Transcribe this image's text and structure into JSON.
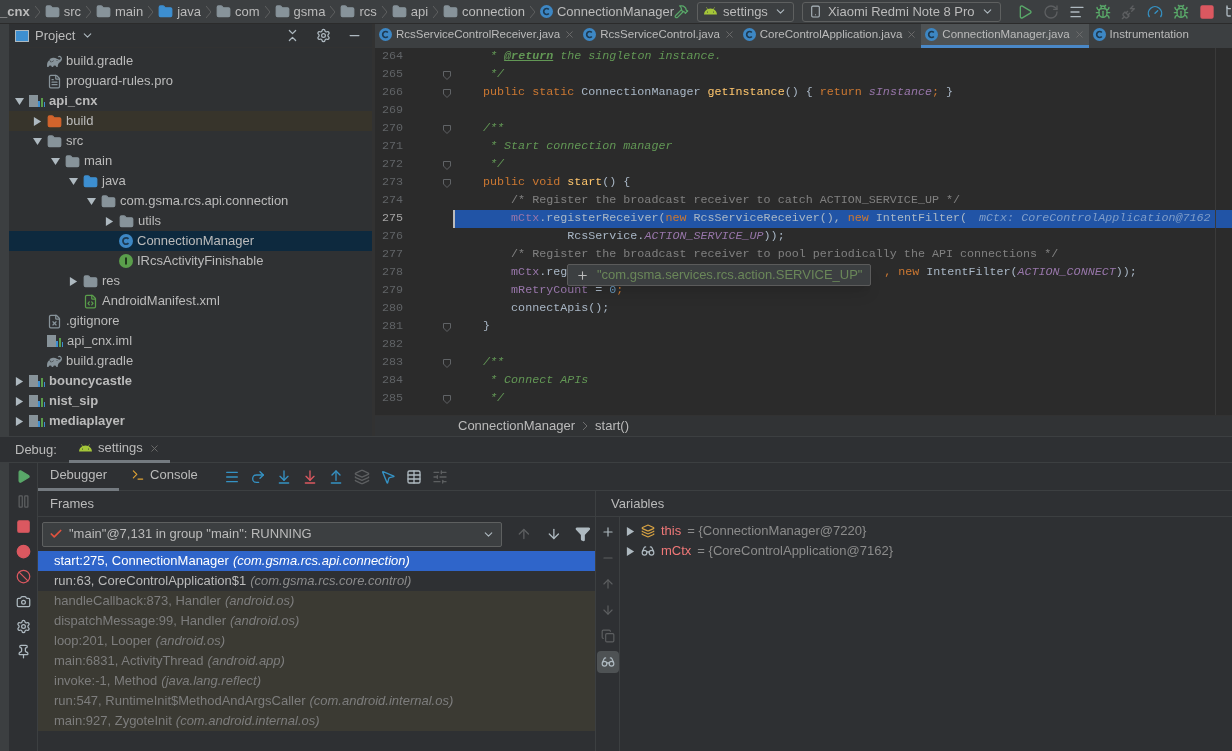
{
  "breadcrumbs": [
    {
      "label": "_cnx",
      "kind": "module"
    },
    {
      "label": "src",
      "kind": "folder"
    },
    {
      "label": "main",
      "kind": "folder"
    },
    {
      "label": "java",
      "kind": "source"
    },
    {
      "label": "com",
      "kind": "package"
    },
    {
      "label": "gsma",
      "kind": "package"
    },
    {
      "label": "rcs",
      "kind": "package"
    },
    {
      "label": "api",
      "kind": "package"
    },
    {
      "label": "connection",
      "kind": "package"
    },
    {
      "label": "ConnectionManager",
      "kind": "class"
    }
  ],
  "toolbar": {
    "run_config": "settings",
    "device": "Xiaomi Redmi Note 8 Pro",
    "icons": [
      {
        "kind": "run",
        "disabled": false
      },
      {
        "kind": "rerun",
        "disabled": true
      },
      {
        "kind": "coverage",
        "disabled": false
      },
      {
        "kind": "debug",
        "disabled": false
      },
      {
        "kind": "attach",
        "disabled": true
      },
      {
        "kind": "profile",
        "disabled": false
      },
      {
        "kind": "attach_debugger",
        "disabled": false
      },
      {
        "kind": "stop",
        "disabled": false
      },
      {
        "kind": "structure",
        "disabled": false
      }
    ]
  },
  "project_panel": {
    "title": "Project",
    "tree": [
      {
        "children": [
          {
            "label": "build.gradle",
            "kind": "gradle"
          },
          {
            "label": "proguard-rules.pro",
            "kind": "file"
          }
        ]
      },
      {
        "label": "api_cnx",
        "kind": "module",
        "expanded": true,
        "selected": false,
        "children": [
          {
            "label": "build",
            "kind": "excluded",
            "expanded": false,
            "selected": false
          },
          {
            "label": "src",
            "kind": "folder",
            "expanded": true,
            "selected": false,
            "children": [
              {
                "label": "main",
                "kind": "folder",
                "expanded": true,
                "selected": false,
                "children": [
                  {
                    "label": "java",
                    "kind": "source",
                    "expanded": true,
                    "selected": false,
                    "children": [
                      {
                        "label": "com.gsma.rcs.api.connection",
                        "kind": "package",
                        "expanded": true,
                        "selected": false,
                        "children": [
                          {
                            "label": "utils",
                            "kind": "package",
                            "expanded": false,
                            "selected": false
                          },
                          {
                            "label": "ConnectionManager",
                            "kind": "class",
                            "selected": true
                          },
                          {
                            "label": "IRcsActivityFinishable",
                            "kind": "interface",
                            "selected": false
                          }
                        ]
                      }
                    ]
                  },
                  {
                    "label": "res",
                    "kind": "res",
                    "expanded": false,
                    "selected": false
                  },
                  {
                    "label": "AndroidManifest.xml",
                    "kind": "manifest",
                    "selected": false
                  }
                ]
              }
            ]
          },
          {
            "label": ".gitignore",
            "kind": "gitignore",
            "selected": false
          },
          {
            "label": "api_cnx.iml",
            "kind": "iml",
            "selected": false
          },
          {
            "label": "build.gradle",
            "kind": "gradle",
            "selected": false
          }
        ]
      },
      {
        "label": "bouncycastle",
        "kind": "module",
        "expanded": false,
        "selected": false
      },
      {
        "label": "nist_sip",
        "kind": "module",
        "expanded": false,
        "selected": false
      },
      {
        "label": "mediaplayer",
        "kind": "module",
        "expanded": false,
        "selected": false
      }
    ]
  },
  "tabs": [
    {
      "label": "RcsServiceControlReceiver.java",
      "selected": false
    },
    {
      "label": "RcsServiceControl.java",
      "selected": false
    },
    {
      "label": "CoreControlApplication.java",
      "selected": false
    },
    {
      "label": "ConnectionManager.java",
      "selected": true
    },
    {
      "label": "Instrumentation",
      "selected": false
    }
  ],
  "code": [
    {
      "num": "264",
      "fold": false,
      "current": false,
      "parts": [
        [
          {
            "kind": "doc",
            "text": "     * "
          },
          {
            "kind": "doctag",
            "text": "@return"
          },
          {
            "kind": "doc",
            "text": " the singleton instance."
          }
        ]
      ]
    },
    {
      "num": "265",
      "fold": true,
      "current": false,
      "parts": [
        [
          {
            "kind": "doc",
            "text": "     */"
          }
        ]
      ]
    },
    {
      "num": "266",
      "fold": true,
      "current": false,
      "parts": [
        [
          {
            "kind": "kw",
            "text": "    public static "
          },
          {
            "kind": "plain",
            "text": "ConnectionManager "
          },
          {
            "kind": "method",
            "text": "getInstance"
          },
          {
            "kind": "plain",
            "text": "() { "
          },
          {
            "kind": "kw",
            "text": "return "
          },
          {
            "kind": "static",
            "text": "sInstance"
          },
          {
            "kind": "kw",
            "text": ";"
          },
          {
            "kind": "plain",
            "text": " }"
          }
        ]
      ]
    },
    {
      "num": "269",
      "fold": false,
      "current": false
    },
    {
      "num": "270",
      "fold": true,
      "current": false,
      "parts": [
        [
          {
            "kind": "doc",
            "text": "    /**"
          }
        ]
      ]
    },
    {
      "num": "271",
      "fold": false,
      "current": false,
      "parts": [
        [
          {
            "kind": "doc",
            "text": "     * Start connection manager"
          }
        ]
      ]
    },
    {
      "num": "272",
      "fold": true,
      "current": false,
      "parts": [
        [
          {
            "kind": "doc",
            "text": "     */"
          }
        ]
      ]
    },
    {
      "num": "273",
      "fold": true,
      "current": false,
      "parts": [
        [
          {
            "kind": "kw",
            "text": "    public void "
          },
          {
            "kind": "method",
            "text": "start"
          },
          {
            "kind": "plain",
            "text": "() {"
          }
        ]
      ]
    },
    {
      "num": "274",
      "fold": false,
      "current": false,
      "parts": [
        [
          {
            "kind": "comment",
            "text": "        /* Register the broadcast receiver to catch ACTION_SERVICE_UP */"
          }
        ]
      ]
    },
    {
      "num": "275",
      "fold": false,
      "current": true,
      "hint": "mCtx: CoreControlApplication@7162",
      "parts": [
        [
          {
            "kind": "field",
            "text": "        mCtx"
          },
          {
            "kind": "plain",
            "text": ".registerReceiver("
          },
          {
            "kind": "kw",
            "text": "new "
          },
          {
            "kind": "plain",
            "text": "RcsServiceReceiver(), "
          },
          {
            "kind": "kw",
            "text": "new "
          },
          {
            "kind": "plain",
            "text": "IntentFilter("
          }
        ]
      ]
    },
    {
      "num": "276",
      "fold": false,
      "current": false,
      "parts": [
        [
          {
            "kind": "plain",
            "text": "                RcsService."
          },
          {
            "kind": "static",
            "text": "ACTION_SERVICE_UP"
          },
          {
            "kind": "plain",
            "text": "));"
          }
        ]
      ]
    },
    {
      "num": "277",
      "fold": false,
      "current": false,
      "parts": [
        [
          {
            "kind": "comment",
            "text": "        /* Register the broadcast receiver to pool periodically the API connections */"
          }
        ]
      ]
    },
    {
      "num": "278",
      "fold": false,
      "current": false,
      "parts": [
        [
          {
            "kind": "field",
            "text": "        mCtx"
          },
          {
            "kind": "plain",
            "text": ".reg"
          }
        ],
        [
          {
            "kind": "kw",
            "text": ", new "
          },
          {
            "kind": "plain",
            "text": "IntentFilter("
          },
          {
            "kind": "static",
            "text": "ACTION_CONNECT"
          },
          {
            "kind": "plain",
            "text": "));"
          }
        ]
      ]
    },
    {
      "num": "279",
      "fold": false,
      "current": false,
      "parts": [
        [
          {
            "kind": "field",
            "text": "        mRetryCount"
          },
          {
            "kind": "plain",
            "text": " = "
          },
          {
            "kind": "num",
            "text": "0"
          },
          {
            "kind": "kw",
            "text": ";"
          }
        ]
      ]
    },
    {
      "num": "280",
      "fold": false,
      "current": false,
      "parts": [
        [
          {
            "kind": "plain",
            "text": "        connectApis();"
          }
        ]
      ]
    },
    {
      "num": "281",
      "fold": true,
      "current": false,
      "parts": [
        [
          {
            "kind": "plain",
            "text": "    }"
          }
        ]
      ]
    },
    {
      "num": "282",
      "fold": false,
      "current": false
    },
    {
      "num": "283",
      "fold": true,
      "current": false,
      "parts": [
        [
          {
            "kind": "doc",
            "text": "    /**"
          }
        ]
      ]
    },
    {
      "num": "284",
      "fold": false,
      "current": false,
      "parts": [
        [
          {
            "kind": "doc",
            "text": "     * Connect APIs"
          }
        ]
      ]
    },
    {
      "num": "285",
      "fold": true,
      "current": false,
      "parts": [
        [
          {
            "kind": "doc",
            "text": "     */"
          }
        ]
      ]
    }
  ],
  "tooltip": {
    "text": "\"com.gsma.services.rcs.action.SERVICE_UP\""
  },
  "editor_breadcrumbs": [
    "ConnectionManager",
    "start()"
  ],
  "debug": {
    "label": "Debug:",
    "session": {
      "label": "settings",
      "selected": true
    },
    "side_icons": [
      {
        "kind": "resume",
        "disabled": false
      },
      {
        "kind": "pause",
        "disabled": true
      },
      {
        "kind": "stop",
        "disabled": false
      },
      {
        "kind": "breakpoints",
        "disabled": false
      },
      {
        "kind": "mute",
        "disabled": false
      },
      {
        "kind": "camera",
        "disabled": false
      },
      {
        "kind": "settings",
        "disabled": false
      },
      {
        "kind": "pin",
        "disabled": false
      }
    ],
    "tabs": [
      {
        "label": "Debugger",
        "kind": "debugger",
        "selected": true
      },
      {
        "label": "Console",
        "kind": "console",
        "selected": false
      }
    ],
    "toolbar_icons": [
      {
        "kind": "threads",
        "disabled": false
      },
      {
        "kind": "step_over",
        "disabled": false
      },
      {
        "kind": "step_into",
        "disabled": false
      },
      {
        "kind": "force_step_into",
        "disabled": false
      },
      {
        "kind": "step_out",
        "disabled": false
      },
      {
        "kind": "drop_frame",
        "disabled": true
      },
      {
        "kind": "run_to_cursor",
        "disabled": false
      },
      {
        "kind": "evaluate",
        "disabled": false
      },
      {
        "kind": "trace",
        "disabled": true
      }
    ],
    "frames_title": "Frames",
    "thread": "\"main\"@7,131 in group \"main\": RUNNING",
    "frame_nav": [
      {
        "kind": "up",
        "disabled": true
      },
      {
        "kind": "down",
        "disabled": false
      },
      {
        "kind": "filter",
        "disabled": false
      }
    ],
    "frames": [
      {
        "method": "start:275, ConnectionManager",
        "package": "(com.gsma.rcs.api.connection)",
        "selected": true,
        "library": false
      },
      {
        "method": "run:63, CoreControlApplication$1",
        "package": "(com.gsma.rcs.core.control)",
        "selected": false,
        "library": false
      },
      {
        "method": "handleCallback:873, Handler",
        "package": "(android.os)",
        "selected": false,
        "library": true
      },
      {
        "method": "dispatchMessage:99, Handler",
        "package": "(android.os)",
        "selected": false,
        "library": true
      },
      {
        "method": "loop:201, Looper",
        "package": "(android.os)",
        "selected": false,
        "library": true
      },
      {
        "method": "main:6831, ActivityThread",
        "package": "(android.app)",
        "selected": false,
        "library": true
      },
      {
        "method": "invoke:-1, Method",
        "package": "(java.lang.reflect)",
        "selected": false,
        "library": true
      },
      {
        "method": "run:547, RuntimeInit$MethodAndArgsCaller",
        "package": "(com.android.internal.os)",
        "selected": false,
        "library": true
      },
      {
        "method": "main:927, ZygoteInit",
        "package": "(com.android.internal.os)",
        "selected": false,
        "library": true
      }
    ],
    "variables_title": "Variables",
    "variable_icons": [
      {
        "kind": "add",
        "disabled": false,
        "on": false
      },
      {
        "kind": "remove",
        "disabled": true,
        "on": false
      },
      {
        "kind": "up",
        "disabled": true,
        "on": false
      },
      {
        "kind": "down",
        "disabled": true,
        "on": false
      },
      {
        "kind": "copy",
        "disabled": true,
        "on": false
      },
      {
        "kind": "watches",
        "disabled": false,
        "on": true
      }
    ],
    "variables": [
      {
        "name": "this",
        "value": "= {ConnectionManager@7220}",
        "kind": "object",
        "expanded": false
      },
      {
        "name": "mCtx",
        "value": "= {CoreControlApplication@7162}",
        "kind": "watch",
        "expanded": false
      }
    ]
  }
}
